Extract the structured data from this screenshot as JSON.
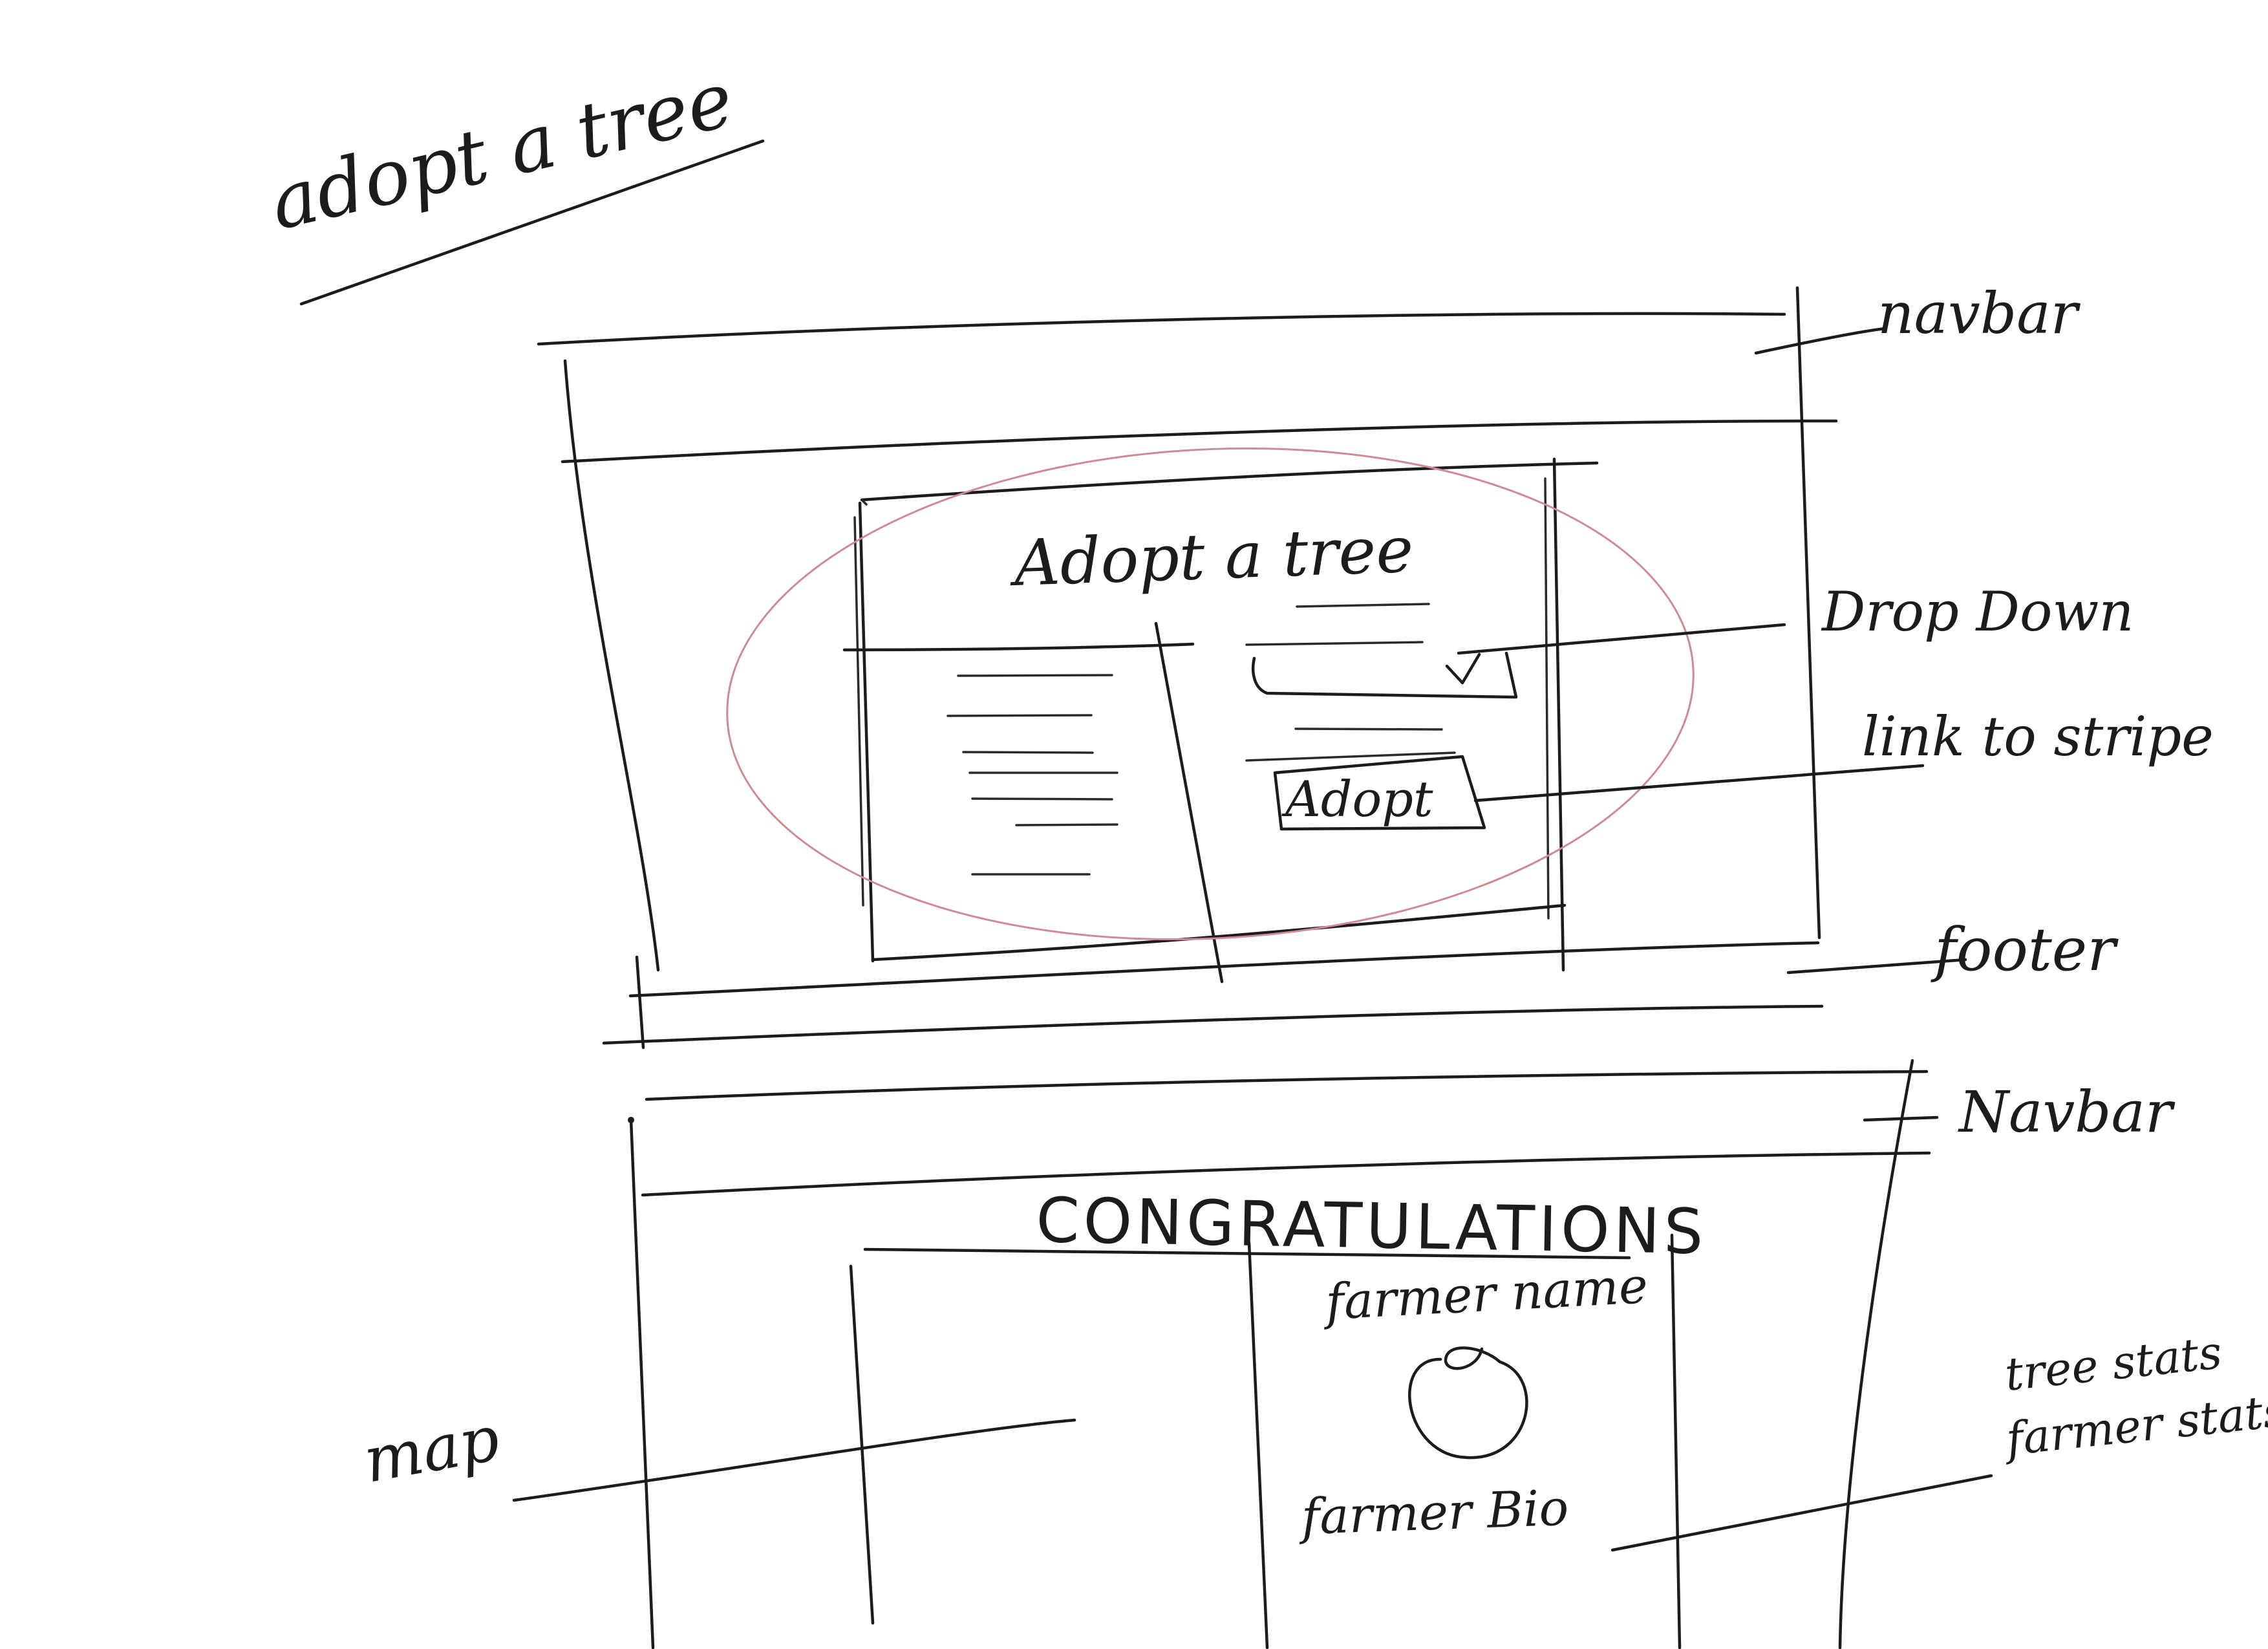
{
  "page_title": "adopt a tree",
  "wireframe_1": {
    "card_title": "Adopt a tree",
    "adopt_button_label": "Adopt"
  },
  "wireframe_2": {
    "heading": "CONGRATULATIONS",
    "farmer_name": "farmer name",
    "farmer_bio": "farmer Bio"
  },
  "annotations": {
    "navbar_1": "navbar",
    "dropdown": "Drop Down",
    "link_to_stripe": "link to stripe",
    "footer": "footer",
    "navbar_2": "Navbar",
    "map": "map",
    "stats_line_1": "tree stats",
    "stats_line_2": "farmer stats"
  },
  "colors": {
    "ink": "#1c1c1c",
    "highlight": "#d08a96",
    "paper": "#ffffff"
  }
}
